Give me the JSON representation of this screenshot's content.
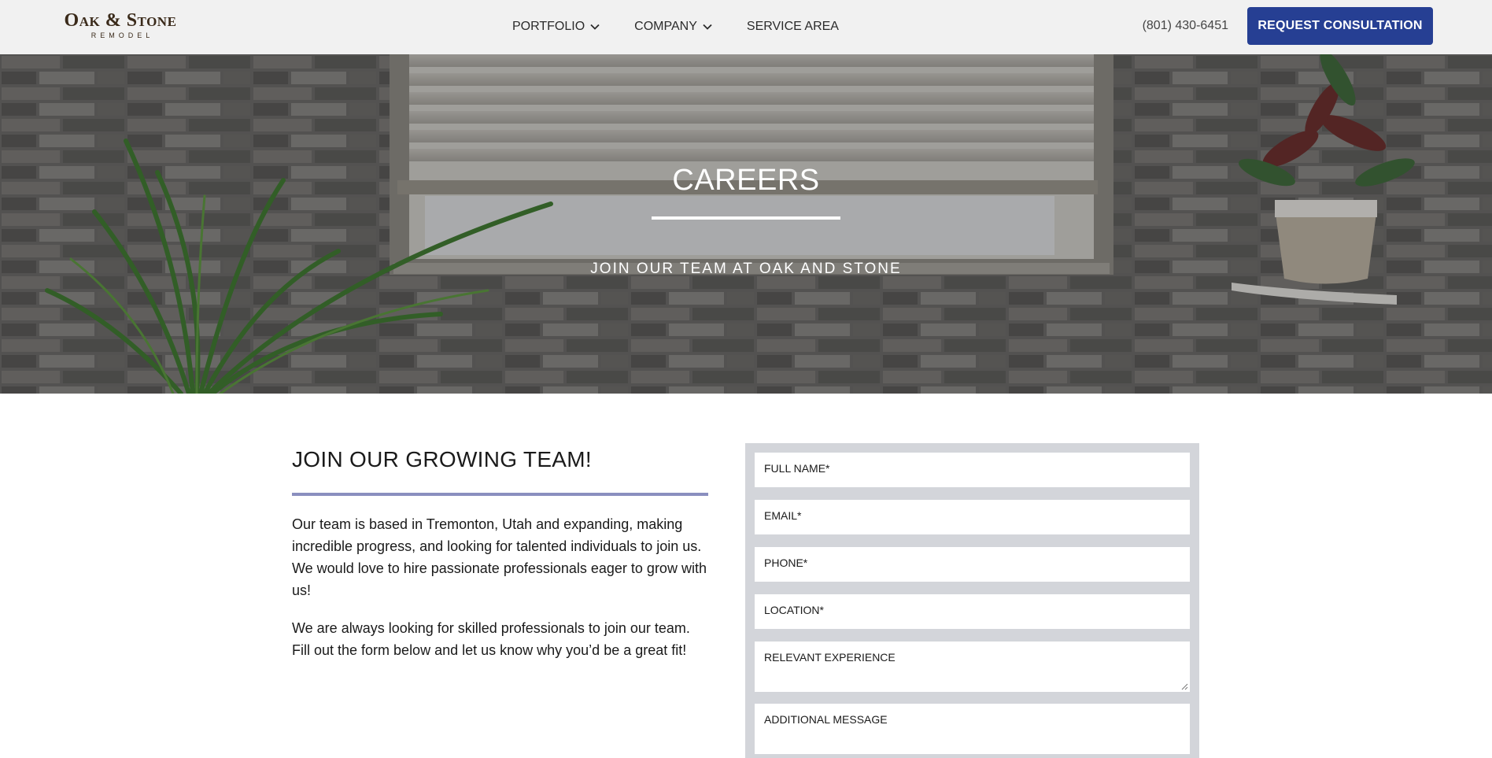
{
  "header": {
    "logo_main": "Oak & Stone",
    "logo_sub": "REMODEL",
    "nav": [
      {
        "label": "PORTFOLIO",
        "has_dropdown": true
      },
      {
        "label": "COMPANY",
        "has_dropdown": true
      },
      {
        "label": "SERVICE AREA",
        "has_dropdown": false
      }
    ],
    "phone": "(801) 430-6451",
    "cta_label": "REQUEST CONSULTATION"
  },
  "hero": {
    "title": "CAREERS",
    "subtitle": "JOIN OUR TEAM AT OAK AND STONE"
  },
  "main": {
    "title": "JOIN OUR GROWING TEAM!",
    "paragraphs": [
      "Our team is based in Tremonton, Utah and expanding, making incredible progress, and looking for talented individuals to join us. We would love to hire passionate professionals eager to grow with us!",
      "We are always looking for skilled professionals to join our team. Fill out the form below and let us know why you’d be a great fit!"
    ]
  },
  "form": {
    "fields": [
      {
        "label": "FULL NAME*"
      },
      {
        "label": "EMAIL*"
      },
      {
        "label": "PHONE*"
      },
      {
        "label": "LOCATION*"
      },
      {
        "label": "RELEVANT EXPERIENCE"
      },
      {
        "label": "ADDITIONAL MESSAGE"
      }
    ]
  },
  "colors": {
    "header_bg": "#f1f1f1",
    "cta_bg": "#263f93",
    "accent_rule": "#8a8fbf",
    "form_bg": "#d3d5da"
  },
  "icons": {
    "nav_dropdown": "chevron-down-icon",
    "textarea_resize": "resize-grip-icon"
  }
}
